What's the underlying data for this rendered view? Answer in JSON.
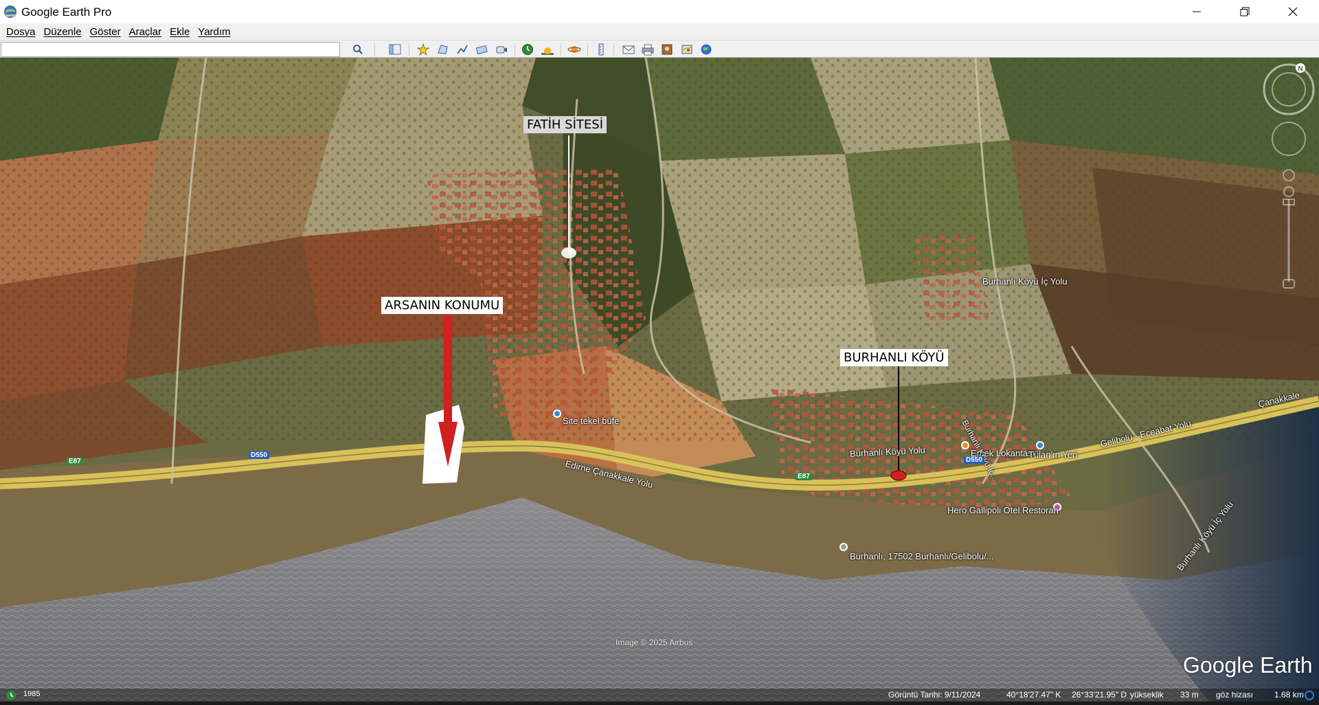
{
  "window": {
    "title": "Google Earth Pro",
    "minimize_glyph": "—",
    "maximize_glyph": "❐",
    "close_glyph": "✕"
  },
  "menu": {
    "items": [
      "Dosya",
      "Düzenle",
      "Göster",
      "Araçlar",
      "Ekle",
      "Yardım"
    ]
  },
  "search": {
    "value": "",
    "placeholder": ""
  },
  "toolbar": {
    "icons": [
      "search-icon",
      "sidebar-toggle-icon",
      "placemark-icon",
      "polygon-icon",
      "path-icon",
      "image-overlay-icon",
      "record-tour-icon",
      "historical-imagery-icon",
      "sunlight-icon",
      "planets-icon",
      "ruler-icon",
      "email-icon",
      "print-icon",
      "save-image-icon",
      "view-in-maps-icon",
      "earth-icon"
    ]
  },
  "map": {
    "callouts": {
      "fatih": "FATİH SİTESİ",
      "arsa": "ARSANIN KONUMU",
      "burhanli": "BURHANLI KÖYÜ"
    },
    "labels": {
      "burhanli_ic_yolu": "Burhanlı Köyü İç Yolu",
      "site_tekel": "Site tekel büfe",
      "edirne_canakkale": "Edirne Çanakkale Yolu",
      "burhanli_koyu_yolu": "Burhanlı Köyü Yolu",
      "emek": "Emek Lokantası",
      "tulanin": "Tülan'ın Yeri",
      "gelibolu_ecebat": "Gelibolu - Eceabat Yolu",
      "canakkale_right": "Çanakkale",
      "hero_gallipoli": "Hero Gallipoli Otel Restoran",
      "burhanli_adres": "Burhanlı, 17502 Burhanlı/Gelibolu/...",
      "burhanli_koyu_ic_yolu_right": "Burhanlı Köyü İç Yolu",
      "burhanli_koyu_vertical": "Burhanlı Köyü İç..."
    },
    "shields": {
      "e87_left": "E87",
      "d550_left": "D550",
      "e87_mid": "E87",
      "d550_right": "D550"
    },
    "imagery_credit": "Image © 2025 Airbus",
    "logo": "Google Earth",
    "year_badge": "1985"
  },
  "status": {
    "date": "Görüntü Tarihi: 9/11/2024",
    "lat": "40°18'27.47\" K",
    "lon": "26°33'21.95\" D",
    "elevation_label": "yükseklik",
    "elevation": "33 m",
    "eye_label": "göz hizası",
    "eye_alt": "1.68 km"
  },
  "colors": {
    "sea": "#7f7f82",
    "farmland_dark": "#4e5a33",
    "farmland_tan": "#a89c76",
    "soil_orange": "#b8734a",
    "road_yellow": "#d9c15a",
    "callout_arrow_red": "#d21f1f"
  }
}
